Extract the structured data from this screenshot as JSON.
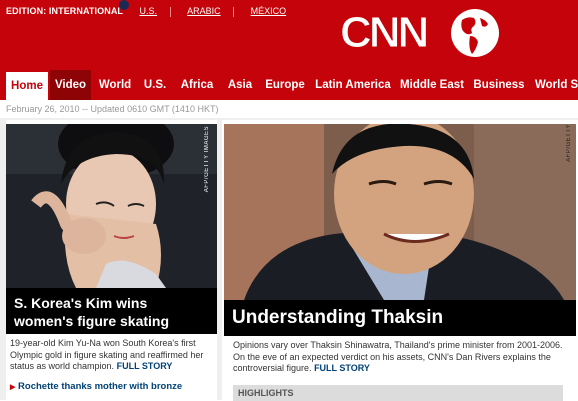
{
  "header": {
    "edition_label": "EDITION: INTERNATIONAL",
    "editions": [
      "U.S.",
      "ARABIC",
      "MÉXICO"
    ],
    "logo_text": "CNN",
    "brand_color": "#c4040a"
  },
  "nav": {
    "items": [
      "Home",
      "Video",
      "World",
      "U.S.",
      "Africa",
      "Asia",
      "Europe",
      "Latin America",
      "Middle East",
      "Business",
      "World S"
    ],
    "active": "Home"
  },
  "datebar": {
    "text": "February 26, 2010 -- Updated 0610 GMT (1410 HKT)"
  },
  "left_story": {
    "photo_credit": "AFP/GETTY IMAGES",
    "headline": "S. Korea's Kim wins women's figure skating",
    "body": "19-year-old Kim Yu-Na won South Korea's first Olympic gold in figure skating and reaffirmed her status as world champion.",
    "full_story": "FULL STORY",
    "related": "Rochette thanks mother with bronze"
  },
  "right_story": {
    "photo_credit": "AFP/GETTY",
    "headline": "Understanding Thaksin",
    "body": "Opinions vary over Thaksin Shinawatra, Thailand's prime minister from 2001-2006. On the eve of an expected verdict on his assets, CNN's Dan Rivers explains the controversial figure.",
    "full_story": "FULL STORY",
    "highlights_label": "HIGHLIGHTS"
  }
}
